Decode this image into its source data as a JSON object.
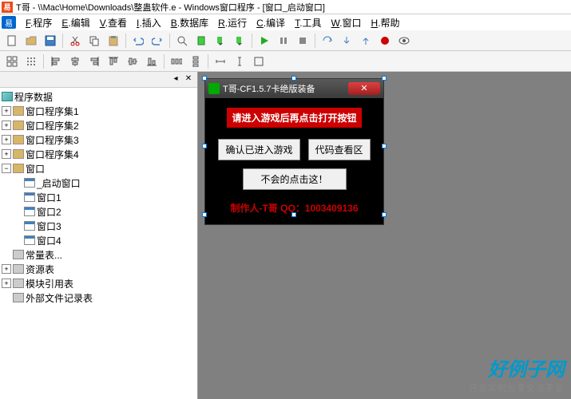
{
  "title": "T哥 - \\\\Mac\\Home\\Downloads\\整蛊软件.e - Windows窗口程序 - [窗口_启动窗口]",
  "menu": [
    {
      "key": "F",
      "label": "程序"
    },
    {
      "key": "E",
      "label": "编辑"
    },
    {
      "key": "V",
      "label": "查看"
    },
    {
      "key": "I",
      "label": "插入"
    },
    {
      "key": "B",
      "label": "数据库"
    },
    {
      "key": "R",
      "label": "运行"
    },
    {
      "key": "C",
      "label": "编译"
    },
    {
      "key": "T",
      "label": "工具"
    },
    {
      "key": "W",
      "label": "窗口"
    },
    {
      "key": "H",
      "label": "帮助"
    }
  ],
  "tree": {
    "root": "程序数据",
    "group1": "窗口程序集1",
    "group2": "窗口程序集2",
    "group3": "窗口程序集3",
    "group4": "窗口程序集4",
    "windows": "窗口",
    "start": "_启动窗口",
    "w1": "窗口1",
    "w2": "窗口2",
    "w3": "窗口3",
    "w4": "窗口4",
    "consts": "常量表...",
    "res": "资源表",
    "mod": "模块引用表",
    "ext": "外部文件记录表"
  },
  "form": {
    "title": "T哥-CF1.5.7卡绝版装备",
    "warning": "请进入游戏后再点击打开按钮",
    "btn1": "确认已进入游戏",
    "btn2": "代码查看区",
    "btn3": "不会的点击这！",
    "credit": "制作人-T哥 QQ：1003409136"
  },
  "watermark": {
    "main": "好例子网",
    "sub": "开发实例分享交流平台"
  }
}
